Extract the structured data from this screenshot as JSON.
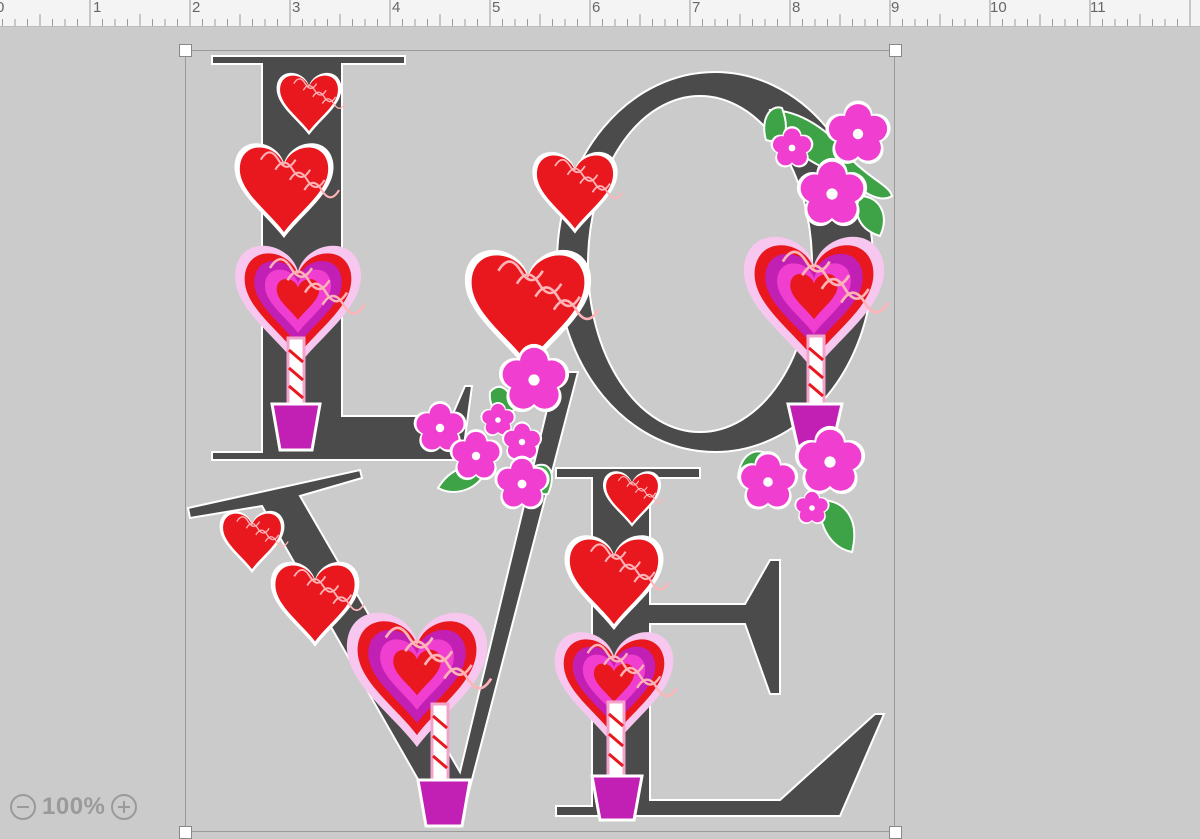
{
  "ruler": {
    "ticks": [
      "0",
      "1",
      "2",
      "3",
      "4",
      "5",
      "6",
      "7",
      "8",
      "9",
      "10",
      "11"
    ]
  },
  "zoom": {
    "level": "100%",
    "zoom_out_icon": "minus-circle-icon",
    "zoom_in_icon": "plus-circle-icon"
  },
  "design": {
    "letters": [
      "L",
      "O",
      "V",
      "E"
    ],
    "colors": {
      "letter": "#4a4a4a",
      "heart_red": "#e8181e",
      "flower_pink": "#f03fd0",
      "leaf_green": "#3ea347",
      "pot_magenta": "#c21fb4",
      "canvas": "#cbcbcb",
      "selection": "#9a9a9a"
    }
  }
}
